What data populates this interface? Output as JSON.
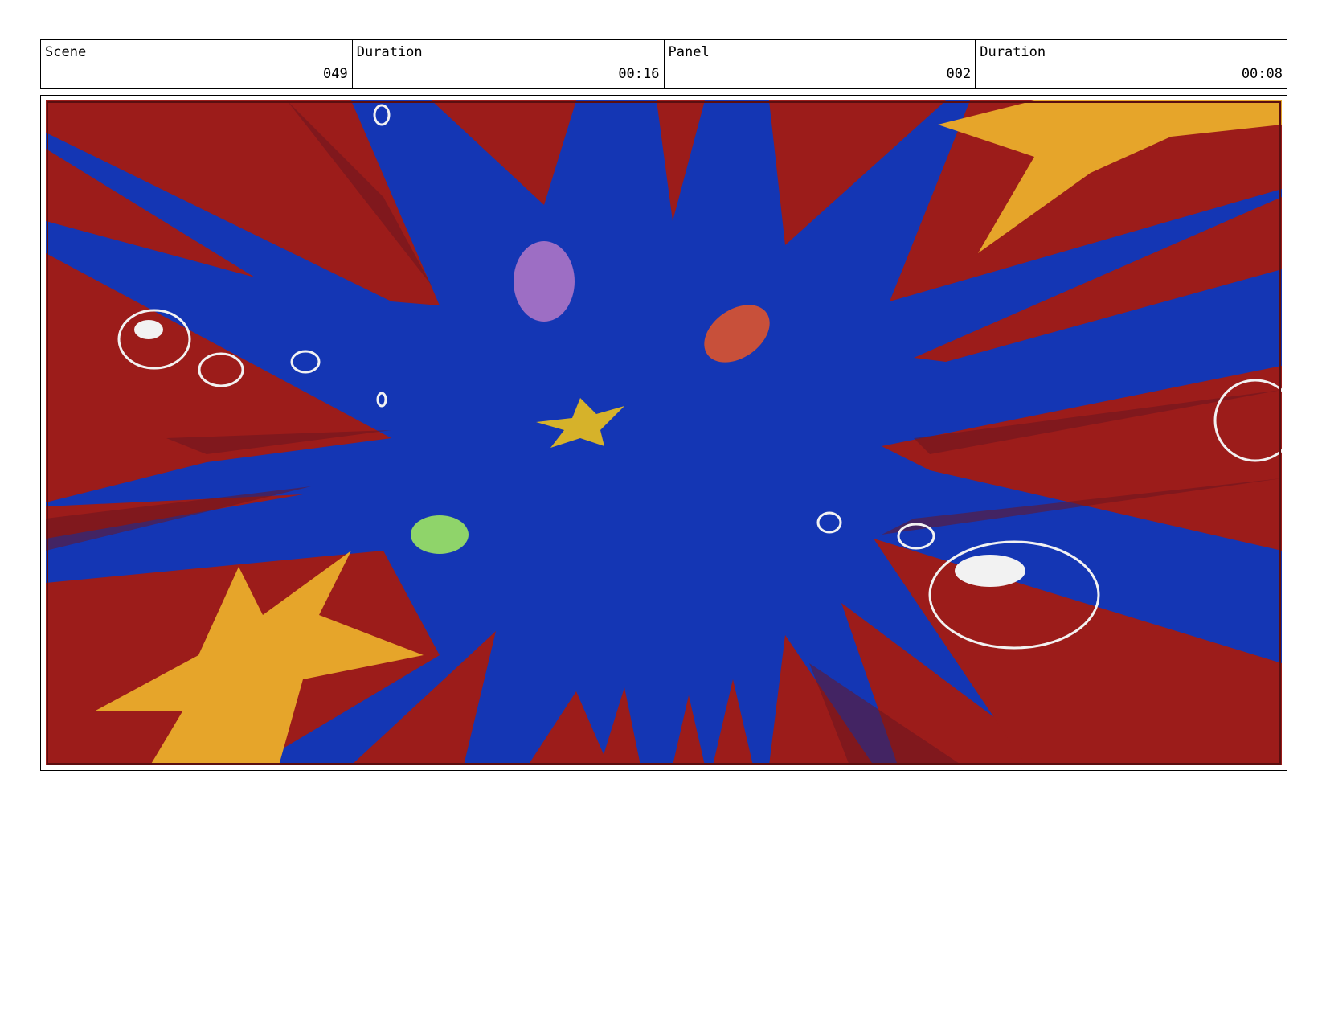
{
  "header": {
    "cells": [
      {
        "label": "Scene",
        "value": "049"
      },
      {
        "label": "Duration",
        "value": "00:16"
      },
      {
        "label": "Panel",
        "value": "002"
      },
      {
        "label": "Duration",
        "value": "00:08"
      }
    ]
  },
  "panel": {
    "colors": {
      "background": "#1436b4",
      "burst": "#9c1c1a",
      "burst_dark": "#6a1520",
      "star": "#e6a52a",
      "star_small": "#d6b22a",
      "purple_shell": "#9d6ec4",
      "red_shell": "#c8503a",
      "green_blob": "#8fd46a",
      "bubble": "#f2f2f2"
    }
  }
}
